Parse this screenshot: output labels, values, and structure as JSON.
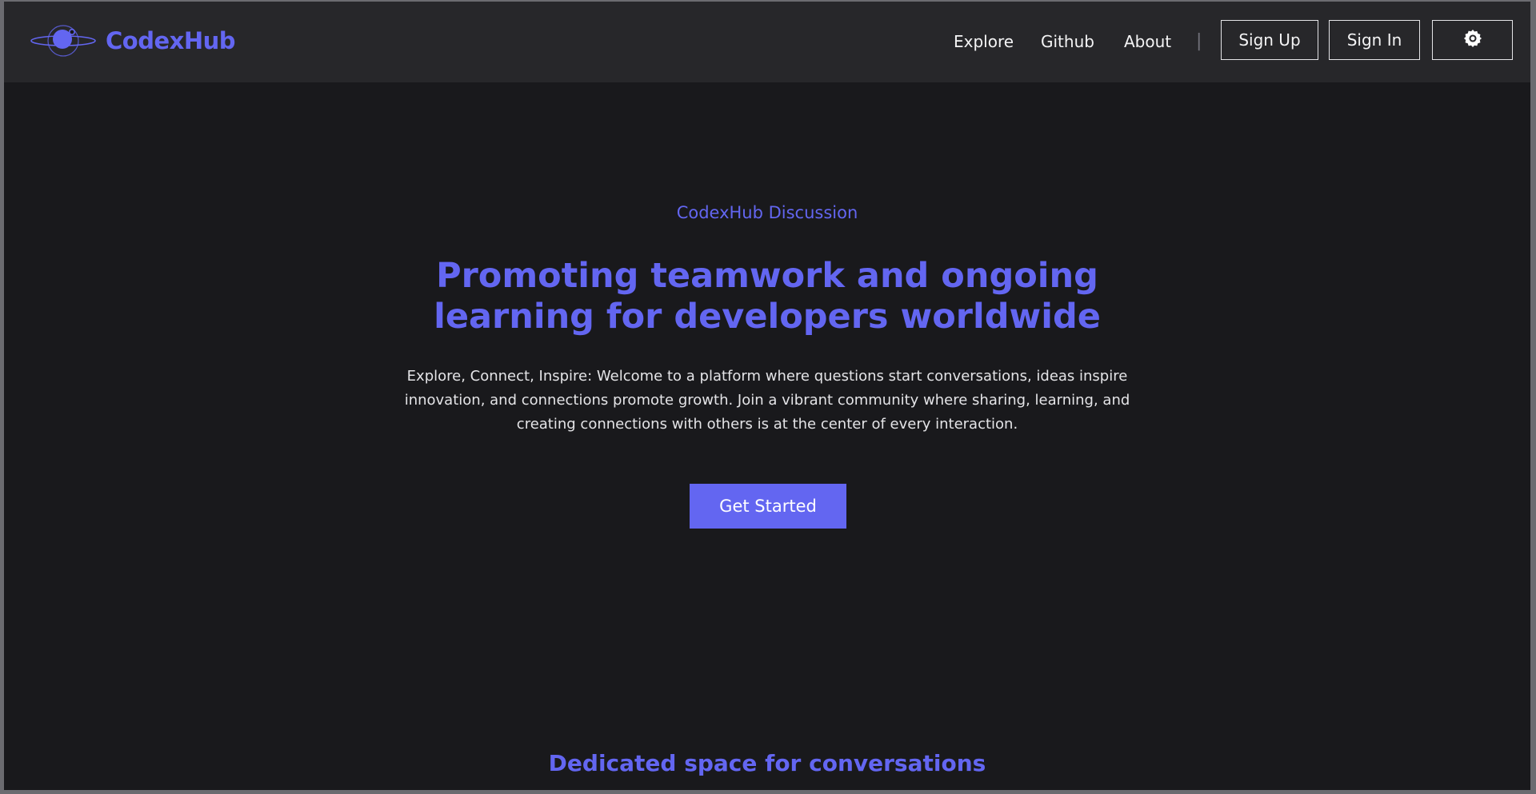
{
  "brand": {
    "name": "CodexHub",
    "logo_icon": "planet-orbit-icon",
    "accent_color": "#6366f1"
  },
  "nav": {
    "links": [
      "Explore",
      "Github",
      "About"
    ],
    "divider": "|",
    "sign_up_label": "Sign Up",
    "sign_in_label": "Sign In",
    "theme_icon": "gear-icon"
  },
  "hero": {
    "eyebrow": "CodexHub Discussion",
    "title_line1": "Promoting teamwork and ongoing",
    "title_line2": "learning for developers worldwide",
    "description": "Explore, Connect, Inspire: Welcome to a platform where questions start conversations, ideas inspire innovation, and connections promote growth. Join a vibrant community where sharing, learning, and creating connections with others is at the center of every interaction.",
    "cta_label": "Get Started"
  },
  "section": {
    "title": "Dedicated space for conversations"
  },
  "colors": {
    "background": "#19191c",
    "navbar": "#27272a",
    "text": "#f4f4f5"
  }
}
